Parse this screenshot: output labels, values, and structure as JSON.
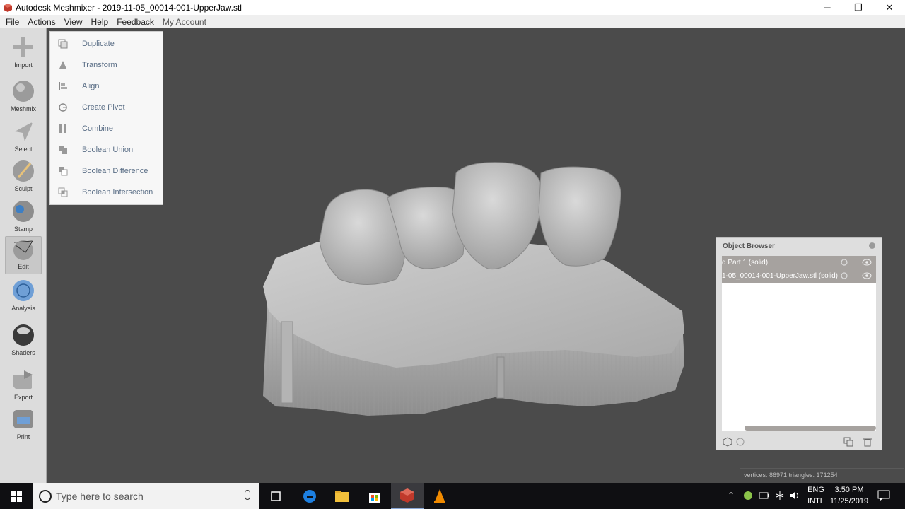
{
  "window": {
    "title": "Autodesk Meshmixer - 2019-11-05_00014-001-UpperJaw.stl",
    "minimize_glyph": "─",
    "restore_glyph": "❐",
    "close_glyph": "✕"
  },
  "menubar": {
    "items": [
      "File",
      "Actions",
      "View",
      "Help",
      "Feedback",
      "My Account"
    ]
  },
  "toolbar": {
    "tools": [
      {
        "label": "Import",
        "icon": "plus-icon"
      },
      {
        "label": "Meshmix",
        "icon": "meshmix-sphere-icon"
      },
      {
        "label": "Select",
        "icon": "arrow-cursor-icon"
      },
      {
        "label": "Sculpt",
        "icon": "brush-icon"
      },
      {
        "label": "Stamp",
        "icon": "stamp-icon"
      },
      {
        "label": "Edit",
        "icon": "edit-sphere-icon"
      },
      {
        "label": "Analysis",
        "icon": "analysis-icon"
      },
      {
        "label": "Shaders",
        "icon": "shader-sphere-icon"
      },
      {
        "label": "Export",
        "icon": "export-icon"
      },
      {
        "label": "Print",
        "icon": "printer-icon"
      }
    ],
    "active": "Edit"
  },
  "edit_menu": {
    "items": [
      {
        "label": "Duplicate",
        "icon": "duplicate-icon"
      },
      {
        "label": "Transform",
        "icon": "transform-icon"
      },
      {
        "label": "Align",
        "icon": "align-icon"
      },
      {
        "label": "Create Pivot",
        "icon": "pivot-icon"
      },
      {
        "label": "Combine",
        "icon": "combine-icon"
      },
      {
        "label": "Boolean Union",
        "icon": "boolean-union-icon"
      },
      {
        "label": "Boolean Difference",
        "icon": "boolean-difference-icon"
      },
      {
        "label": "Boolean Intersection",
        "icon": "boolean-intersection-icon"
      }
    ]
  },
  "object_browser": {
    "title": "Object Browser",
    "objects": [
      {
        "name": "d Part 1 (solid)"
      },
      {
        "name": "1-05_00014-001-UpperJaw.stl (solid)"
      }
    ]
  },
  "status": {
    "text": "vertices: 86971 triangles: 171254"
  },
  "taskbar": {
    "search_placeholder": "Type here to search",
    "language_top": "ENG",
    "language_bottom": "INTL",
    "time": "3:50 PM",
    "date": "11/25/2019"
  },
  "colors": {
    "viewport_bg": "#4b4b4b",
    "menu_text": "#5a6e86",
    "object_row": "#a6a29f",
    "taskbar_bg": "#0f0f12"
  }
}
